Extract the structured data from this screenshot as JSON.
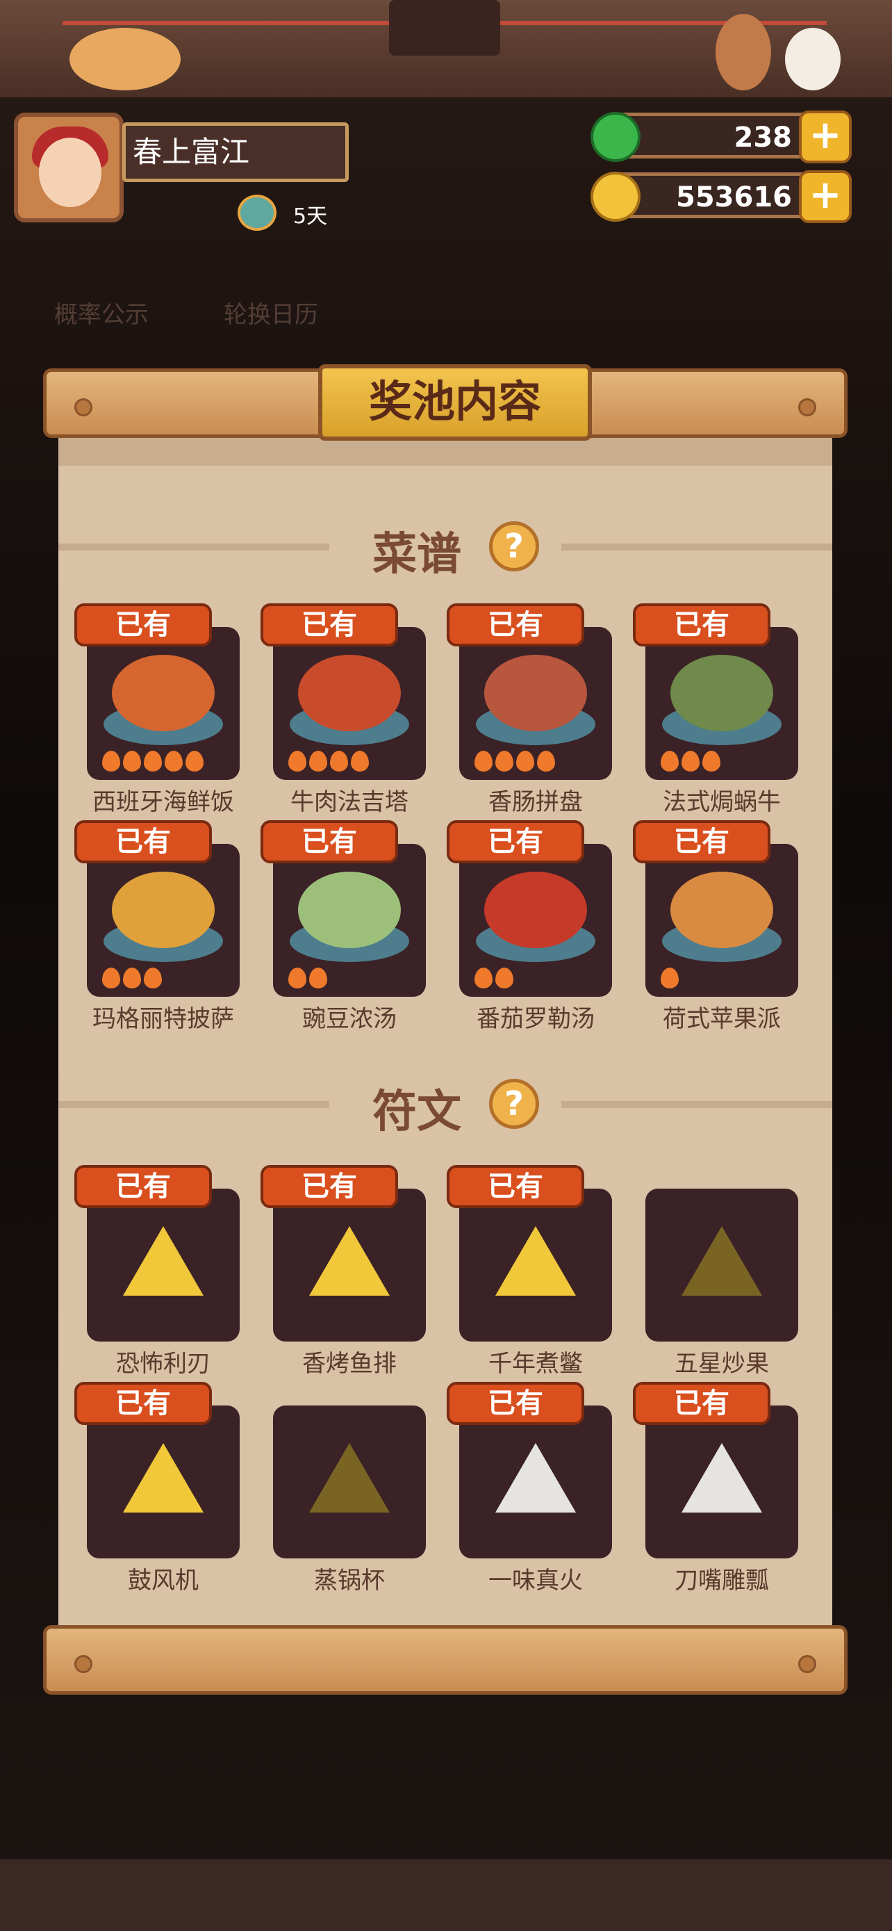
{
  "player": {
    "name": "春上富江",
    "days": "5天"
  },
  "currency": {
    "jade": "238",
    "coins": "553616",
    "plus": "+"
  },
  "background_buttons": {
    "probability": "概率公示",
    "calendar": "轮换日历"
  },
  "panel": {
    "title": "奖池内容"
  },
  "owned_label": "已有",
  "recipes": {
    "heading": "菜谱",
    "help": "?",
    "items": [
      {
        "name": "西班牙海鲜饭",
        "owned": true,
        "stars": 5,
        "color": "#d5662f"
      },
      {
        "name": "牛肉法吉塔",
        "owned": true,
        "stars": 4,
        "color": "#c84b2b"
      },
      {
        "name": "香肠拼盘",
        "owned": true,
        "stars": 4,
        "color": "#b9573e"
      },
      {
        "name": "法式焗蜗牛",
        "owned": true,
        "stars": 3,
        "color": "#6f8a4a"
      },
      {
        "name": "玛格丽特披萨",
        "owned": true,
        "stars": 3,
        "color": "#e0a13a"
      },
      {
        "name": "豌豆浓汤",
        "owned": true,
        "stars": 2,
        "color": "#9cc07a"
      },
      {
        "name": "番茄罗勒汤",
        "owned": true,
        "stars": 2,
        "color": "#c63a2a"
      },
      {
        "name": "荷式苹果派",
        "owned": true,
        "stars": 1,
        "color": "#d98b42"
      }
    ]
  },
  "runes": {
    "heading": "符文",
    "help": "?",
    "items": [
      {
        "name": "恐怖利刃",
        "owned": true,
        "style": "gold"
      },
      {
        "name": "香烤鱼排",
        "owned": true,
        "style": "gold"
      },
      {
        "name": "千年煮鳖",
        "owned": true,
        "style": "gold"
      },
      {
        "name": "五星炒果",
        "owned": false,
        "style": "dim"
      },
      {
        "name": "鼓风机",
        "owned": true,
        "style": "gold"
      },
      {
        "name": "蒸锅杯",
        "owned": false,
        "style": "dim"
      },
      {
        "name": "一味真火",
        "owned": true,
        "style": "silver"
      },
      {
        "name": "刀嘴雕瓢",
        "owned": true,
        "style": "silver"
      }
    ]
  }
}
